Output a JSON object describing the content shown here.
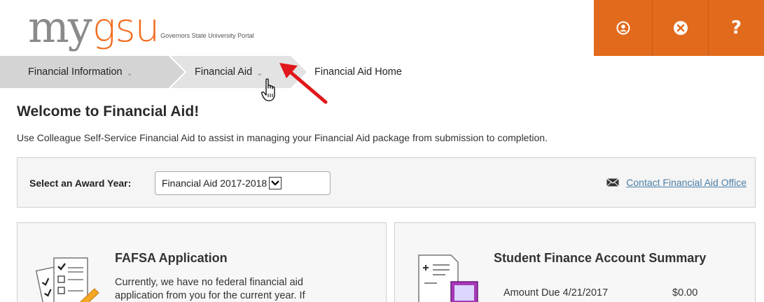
{
  "header": {
    "logo_my": "my",
    "logo_gsu": "gsu",
    "logo_tagline": "Governors State University Portal",
    "buttons": [
      {
        "icon": "user-icon"
      },
      {
        "icon": "close-circle-icon"
      },
      {
        "icon": "help-icon",
        "label": "?"
      }
    ],
    "accent_color": "#e26a1c"
  },
  "breadcrumb": {
    "items": [
      {
        "label": "Financial Information",
        "has_dropdown": true
      },
      {
        "label": "Financial Aid",
        "has_dropdown": true
      },
      {
        "label": "Financial Aid Home",
        "has_dropdown": false
      }
    ]
  },
  "main": {
    "title": "Welcome to Financial Aid!",
    "intro": "Use Colleague Self-Service Financial Aid to assist in managing your Financial Aid package from submission to completion.",
    "award_year": {
      "label": "Select an Award Year:",
      "selected": "Financial Aid 2017-2018"
    },
    "contact_link": "Contact Financial Aid Office",
    "cards": {
      "fafsa": {
        "title": "FAFSA Application",
        "text_line1": "Currently, we have no federal financial aid",
        "text_line2": "application from you for the current year. If"
      },
      "finance": {
        "title": "Student Finance Account Summary",
        "row_label": "Amount Due 4/21/2017",
        "row_value": "$0.00"
      }
    }
  }
}
